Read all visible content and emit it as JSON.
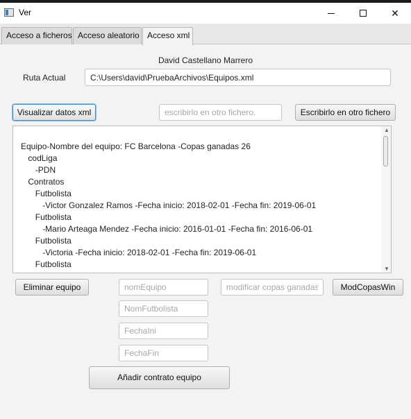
{
  "window": {
    "title": "Ver"
  },
  "tabs": [
    {
      "label": "Acceso a ficheros"
    },
    {
      "label": "Acceso aleatorio"
    },
    {
      "label": "Acceso xml",
      "active": true
    }
  ],
  "main": {
    "author": "David Castellano Marrero",
    "ruta_label": "Ruta Actual",
    "ruta_value": "C:\\Users\\david\\PruebaArchivos\\Equipos.xml",
    "visualizar_label": "Visualizar datos xml",
    "escribir_placeholder": "escribirlo en otro fichero.",
    "escribirlo_label": "Escribirlo en otro fichero",
    "output_lines": [
      "Equipo-Nombre del equipo: FC Barcelona -Copas ganadas 26",
      "    codLiga",
      "        -PDN",
      "    Contratos",
      "        Futbolista",
      "            -Victor Gonzalez Ramos -Fecha inicio: 2018-02-01 -Fecha fin: 2019-06-01",
      "        Futbolista",
      "            -Mario Arteaga Mendez -Fecha inicio: 2016-01-01 -Fecha fin: 2016-06-01",
      "        Futbolista",
      "            -Victoria -Fecha inicio: 2018-02-01 -Fecha fin: 2019-06-01",
      "        Futbolista"
    ],
    "eliminar_label": "Eliminar equipo",
    "nomequipo_placeholder": "nomEquipo",
    "copas_placeholder": "modificar copas ganadas",
    "modcopas_label": "ModCopasWin",
    "nomfutbolista_placeholder": "NomFutbolista",
    "fechaini_placeholder": "FechaIni",
    "fechafin_placeholder": "FechaFin",
    "anadir_label": "Añadir contrato equipo"
  },
  "icons": {
    "minimize": "minimize-icon",
    "maximize": "maximize-icon",
    "close": "close-icon"
  },
  "colors": {
    "focus_border": "#3e8ed0",
    "background": "#f3f3f3"
  }
}
